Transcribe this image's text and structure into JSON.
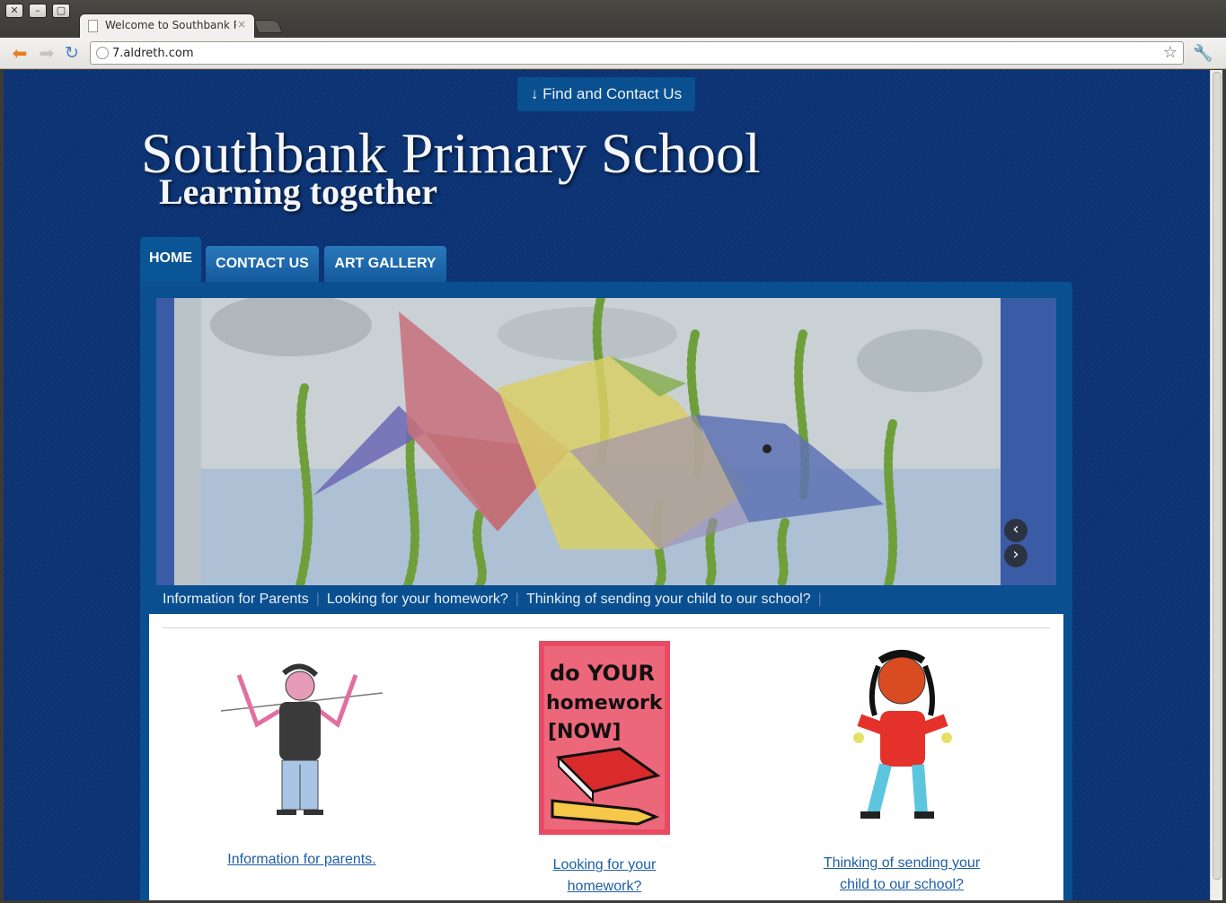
{
  "window": {
    "tab_title": "Welcome to Southbank Pr",
    "tab_close": "×",
    "url": "7.aldreth.com"
  },
  "icons": [
    "back-arrow-icon",
    "forward-arrow-icon",
    "reload-icon",
    "globe-icon",
    "bookmark-star-icon",
    "wrench-icon",
    "close-icon",
    "minimize-icon",
    "maximize-icon"
  ],
  "site": {
    "find_contact": "↓ Find and Contact Us",
    "title": "Southbank Primary School",
    "tagline": "Learning together"
  },
  "nav": {
    "home": "HOME",
    "contact": "CONTACT US",
    "gallery": "ART GALLERY"
  },
  "slider": {
    "prev": "‹",
    "next": "›",
    "links": [
      "Information for Parents",
      "Looking for your homework?",
      "Thinking of sending your child to our school?"
    ],
    "separator": "|"
  },
  "columns": [
    {
      "link": "Information for parents."
    },
    {
      "link": "Looking for your homework?",
      "image_text": [
        "do YOUR",
        "homework",
        "[NOW]"
      ]
    },
    {
      "link_line1": "Thinking of sending your",
      "link_line2": "child to our school?"
    }
  ],
  "colors": {
    "page_background": "#0b3273",
    "panel": "#0a4f8f",
    "link": "#1d5ea8"
  }
}
